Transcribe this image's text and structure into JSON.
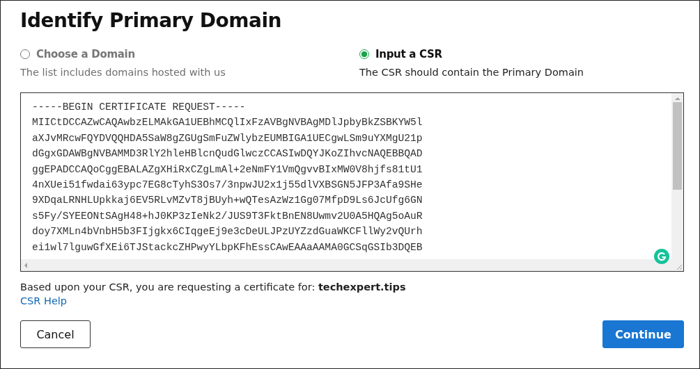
{
  "title": "Identify Primary Domain",
  "options": [
    {
      "label": "Choose a Domain",
      "description": "The list includes domains hosted with us",
      "selected": false
    },
    {
      "label": "Input a CSR",
      "description": "The CSR should contain the Primary Domain",
      "selected": true
    }
  ],
  "csr": {
    "lines": [
      "-----BEGIN CERTIFICATE REQUEST-----",
      "MIICtDCCAZwCAQAwbzELMAkGA1UEBhMCQlIxFzAVBgNVBAgMDlJpbyBkZSBKYW5l",
      "aXJvMRcwFQYDVQQHDA5SaW8gZGUgSmFuZWlybzEUMBIGA1UECgwLSm9uYXMgU21p",
      "dGgxGDAWBgNVBAMMD3RlY2hleHBlcnQudGlwczCCASIwDQYJKoZIhvcNAQEBBQAD",
      "ggEPADCCAQoCggEBALAZgXHiRxCZgLmAl+2eNmFY1VmQgvvBIxMW0V8hjfs81tU1",
      "4nXUei51fwdai63ypc7EG8cTyhS3Os7/3npwJU2x1j55dlVXBSGN5JFP3Afa9SHe",
      "9XDqaLRNHLUpkkaj6EV5RLvMZvT8jBUyh+wQTesAzWz1Gg07MfpD9Ls6JcUfg6GN",
      "s5Fy/SYEEONtSAgH48+hJ0KP3zIeNk2/JUS9T3FktBnEN8Uwmv2U0A5HQAg5oAuR",
      "doy7XMLn4bVnbH5b3FIjgkx6CIqgeEj9e3cDeULJPzUYZzdGuaWKCFllWy2vQUrh",
      "ei1wl7lguwGfXEi6TJStackcZHPwyYLbpKFhEssCAwEAAaAAMA0GCSqGSIb3DQEB"
    ]
  },
  "result": {
    "text": "Based upon your CSR, you are requesting a certificate for:",
    "domain": "techexpert.tips"
  },
  "help_link": "CSR Help",
  "buttons": {
    "cancel": "Cancel",
    "continue": "Continue"
  }
}
